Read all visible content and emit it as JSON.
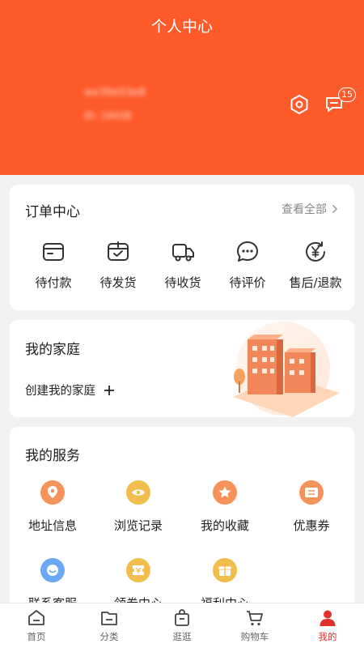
{
  "header": {
    "title": "个人中心",
    "user_name": "wx39e53e8",
    "user_sub": "ID: 18438",
    "message_badge": "15"
  },
  "orders": {
    "title": "订单中心",
    "see_all": "查看全部",
    "items": [
      {
        "label": "待付款",
        "icon": "wallet-icon"
      },
      {
        "label": "待发货",
        "icon": "package-check-icon"
      },
      {
        "label": "待收货",
        "icon": "truck-icon"
      },
      {
        "label": "待评价",
        "icon": "comment-icon"
      },
      {
        "label": "售后/退款",
        "icon": "refund-icon"
      }
    ]
  },
  "family": {
    "title": "我的家庭",
    "create": "创建我的家庭"
  },
  "services": {
    "title": "我的服务",
    "items": [
      {
        "label": "地址信息",
        "icon": "location-icon",
        "color": "#f07a3c"
      },
      {
        "label": "浏览记录",
        "icon": "eye-icon",
        "color": "#f0b53a"
      },
      {
        "label": "我的收藏",
        "icon": "star-icon",
        "color": "#f07a3c"
      },
      {
        "label": "优惠券",
        "icon": "coupon-icon",
        "color": "#f07a3c"
      },
      {
        "label": "联系客服",
        "icon": "service-icon",
        "color": "#5aa0f0"
      },
      {
        "label": "领券中心",
        "icon": "ticket-icon",
        "color": "#f0b53a"
      },
      {
        "label": "福利中心",
        "icon": "gift-icon",
        "color": "#f0b53a"
      }
    ]
  },
  "tabbar": {
    "items": [
      {
        "label": "首页",
        "icon": "home-icon"
      },
      {
        "label": "分类",
        "icon": "category-icon"
      },
      {
        "label": "逛逛",
        "icon": "shopping-bag-icon"
      },
      {
        "label": "购物车",
        "icon": "cart-icon"
      },
      {
        "label": "我的",
        "icon": "profile-icon"
      }
    ],
    "active_index": 4,
    "active_color": "#e0312c"
  },
  "colors": {
    "brand": "#ff5a2a"
  }
}
